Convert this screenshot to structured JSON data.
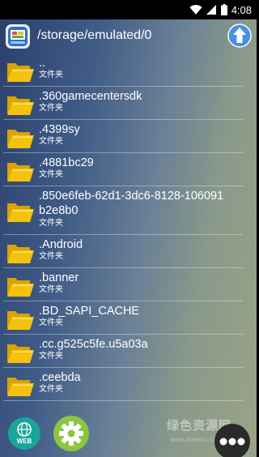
{
  "status_bar": {
    "time": "4:08",
    "icons": [
      "wifi-icon",
      "signal-icon",
      "battery-icon"
    ]
  },
  "header": {
    "path": "/storage/emulated/0",
    "app_icon": "file-manager-app-icon",
    "up_icon": "up-arrow-icon"
  },
  "files": [
    {
      "name": "..",
      "type": "文件夹"
    },
    {
      "name": ".360gamecentersdk",
      "type": "文件夹"
    },
    {
      "name": ".4399sy",
      "type": "文件夹"
    },
    {
      "name": ".4881bc29",
      "type": "文件夹"
    },
    {
      "name": ".850e6feb-62d1-3dc6-8128-106091",
      "name_line2": "b2e8b0",
      "type": "文件夹"
    },
    {
      "name": ".Android",
      "type": "文件夹"
    },
    {
      "name": ".banner",
      "type": "文件夹"
    },
    {
      "name": ".BD_SAPI_CACHE",
      "type": "文件夹"
    },
    {
      "name": ".cc.g525c5fe.u5a03a",
      "type": "文件夹"
    },
    {
      "name": ".ceebda",
      "type": "文件夹"
    }
  ],
  "bottom_bar": {
    "web_label": "WEB",
    "watermark": "绿色资源网",
    "watermark_sub": "www.downcc.com"
  },
  "colors": {
    "folder": "#f4c20d",
    "web_button": "#1aa59a",
    "settings_button": "#8cc63f",
    "up_button": "#4a90e2"
  }
}
